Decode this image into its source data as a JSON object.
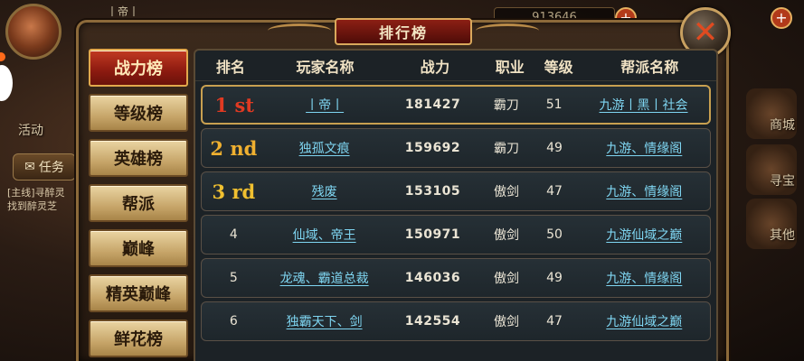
{
  "hud": {
    "activity_label": "活动",
    "task_label": "任务",
    "quest_line1": "[主线]寻醉灵",
    "quest_line2": "找到醉灵芝",
    "shop_label": "商城",
    "treasure_label": "寻宝",
    "other_label": "其他",
    "gold_value": "913646",
    "plus_label": "+",
    "top_name": "丨帝丨"
  },
  "panel": {
    "title": "排行榜",
    "close_label": "✕"
  },
  "tabs": [
    {
      "label": "战力榜",
      "active": true
    },
    {
      "label": "等级榜",
      "active": false
    },
    {
      "label": "英雄榜",
      "active": false
    },
    {
      "label": "帮派",
      "active": false
    },
    {
      "label": "巅峰",
      "active": false
    },
    {
      "label": "精英巅峰",
      "active": false
    },
    {
      "label": "鲜花榜",
      "active": false
    }
  ],
  "table": {
    "headers": {
      "rank": "排名",
      "player": "玩家名称",
      "power": "战力",
      "job": "职业",
      "level": "等级",
      "guild": "帮派名称"
    },
    "rows": [
      {
        "rank": "1 st",
        "player": "丨帝丨",
        "power": "181427",
        "job": "霸刀",
        "level": "51",
        "guild": "九游丨黑丨社会"
      },
      {
        "rank": "2 nd",
        "player": "独孤文痕",
        "power": "159692",
        "job": "霸刀",
        "level": "49",
        "guild": "九游、情缘阁"
      },
      {
        "rank": "3 rd",
        "player": "残废",
        "power": "153105",
        "job": "傲剑",
        "level": "47",
        "guild": "九游、情缘阁"
      },
      {
        "rank": "4",
        "player": "仙域、帝王",
        "power": "150971",
        "job": "傲剑",
        "level": "50",
        "guild": "九游仙域之巅"
      },
      {
        "rank": "5",
        "player": "龙魂、霸道总裁",
        "power": "146036",
        "job": "傲剑",
        "level": "49",
        "guild": "九游、情缘阁"
      },
      {
        "rank": "6",
        "player": "独霸天下、剑",
        "power": "142554",
        "job": "傲剑",
        "level": "47",
        "guild": "九游仙域之巅"
      }
    ]
  }
}
